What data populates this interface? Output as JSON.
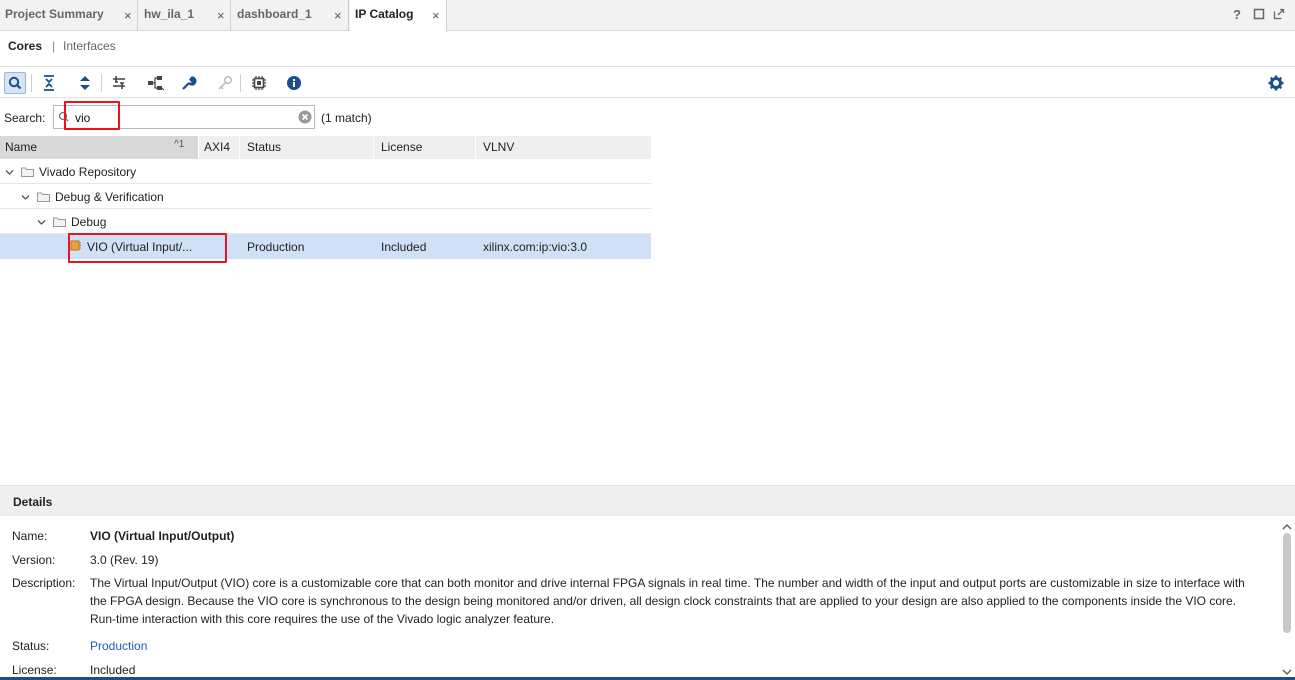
{
  "tabs": [
    {
      "label": "Project Summary",
      "active": false
    },
    {
      "label": "hw_ila_1",
      "active": false
    },
    {
      "label": "dashboard_1",
      "active": false
    },
    {
      "label": "IP Catalog",
      "active": true
    }
  ],
  "tab_close_glyph": "×",
  "window_controls": {
    "help": "?"
  },
  "subtabs": {
    "cores": "Cores",
    "separator": "|",
    "interfaces": "Interfaces"
  },
  "toolbar": {
    "icons": [
      "search-icon",
      "collapse-all-icon",
      "expand-all-icon",
      "filter-icon",
      "hierarchy-icon",
      "customize-ip-icon",
      "license-key-icon",
      "chip-icon",
      "info-icon",
      "gear-icon"
    ]
  },
  "search": {
    "label": "Search:",
    "value": "vio",
    "match": "(1 match)"
  },
  "table": {
    "columns": [
      "Name",
      "AXI4",
      "Status",
      "License",
      "VLNV"
    ],
    "sort_indicator": "^1",
    "rows": [
      {
        "name": "Vivado Repository",
        "level": 0,
        "axi4": "",
        "status": "",
        "license": "",
        "vlnv": ""
      },
      {
        "name": "Debug & Verification",
        "level": 1,
        "axi4": "",
        "status": "",
        "license": "",
        "vlnv": ""
      },
      {
        "name": "Debug",
        "level": 2,
        "axi4": "",
        "status": "",
        "license": "",
        "vlnv": ""
      },
      {
        "name": "VIO (Virtual Input/...",
        "level": 3,
        "axi4": "",
        "status": "Production",
        "license": "Included",
        "vlnv": "xilinx.com:ip:vio:3.0",
        "selected": true
      }
    ]
  },
  "details": {
    "title": "Details",
    "name_label": "Name:",
    "name_value": "VIO (Virtual Input/Output)",
    "version_label": "Version:",
    "version_value": "3.0 (Rev. 19)",
    "description_label": "Description:",
    "description_lines": [
      "The Virtual Input/Output (VIO) core is a customizable core that can both monitor and drive internal FPGA signals in real time. The number and width of the input and output ports are customizable in size to interface with",
      "the FPGA design. Because the VIO core is synchronous to the design being monitored and/or driven, all design clock constraints that are applied to your design are also applied to the components inside the VIO core.",
      "Run-time interaction with this core requires the use of the Vivado logic analyzer feature."
    ],
    "status_label": "Status:",
    "status_value": "Production",
    "license_label": "License:",
    "license_value": "Included"
  },
  "colors": {
    "link": "#1a5fb4",
    "selection": "#cfe0f7",
    "highlight": "#e8131b",
    "accent_blue": "#1b4f8a"
  }
}
